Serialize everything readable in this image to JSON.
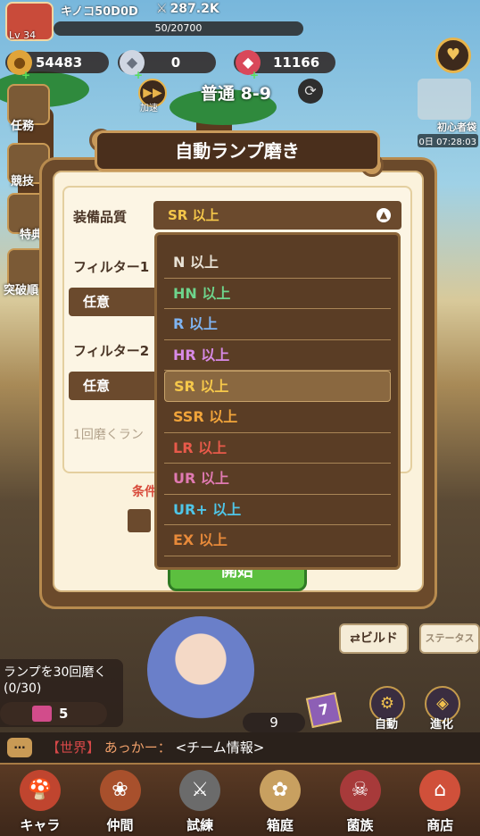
{
  "player": {
    "name": "キノコ50D0D",
    "level": "Lv 34",
    "power": "287.2K",
    "xp": "50/20700"
  },
  "currencies": {
    "gold": "54483",
    "diamond": "0",
    "gem": "11166"
  },
  "stage": {
    "label": "普通 8-9",
    "speed_label": "加速"
  },
  "side_menu": {
    "tasks": "任務",
    "arena": "競技",
    "special": "特典",
    "breakthrough": "突破順"
  },
  "newbie": {
    "label": "初心者袋",
    "timer": "0日 07:28:03"
  },
  "dialog": {
    "title": "自動ランプ磨き",
    "grade_label": "装備品質",
    "grade_value": "SR 以上",
    "filter1_label": "フィルター1",
    "filter1_value": "任意",
    "filter2_label": "フィルター2",
    "filter2_value": "任意",
    "polish_label": "1回磨くラン",
    "condition_label": "条件",
    "start_label": "開始"
  },
  "dropdown": {
    "options": [
      {
        "label": "N 以上",
        "color": "#e8e2d6"
      },
      {
        "label": "HN 以上",
        "color": "#6ed48c"
      },
      {
        "label": "R 以上",
        "color": "#7fb4f2"
      },
      {
        "label": "HR 以上",
        "color": "#d88ae6"
      },
      {
        "label": "SR 以上",
        "color": "#f6c84a"
      },
      {
        "label": "SSR 以上",
        "color": "#f1a43a"
      },
      {
        "label": "LR 以上",
        "color": "#e85a4a"
      },
      {
        "label": "UR 以上",
        "color": "#e07ab2"
      },
      {
        "label": "UR+ 以上",
        "color": "#4fc6e8"
      },
      {
        "label": "EX 以上",
        "color": "#e88a3a"
      }
    ],
    "selected_index": 4
  },
  "bottom": {
    "build": "ビルド",
    "status": "ステータス",
    "lamp_text": "ランプを30回磨く(0/30)",
    "lamp_count": "5",
    "lamp_level": "9",
    "card_level": "7",
    "auto": "自動",
    "evolve": "進化"
  },
  "chat": {
    "channel": "【世界】",
    "name": "あっかー：",
    "message": "<チーム情報>"
  },
  "nav": [
    {
      "label": "キャラ",
      "icon": "mushroom-icon"
    },
    {
      "label": "仲間",
      "icon": "paw-icon"
    },
    {
      "label": "試練",
      "icon": "swords-icon"
    },
    {
      "label": "箱庭",
      "icon": "garden-icon"
    },
    {
      "label": "菌族",
      "icon": "skull-icon"
    },
    {
      "label": "商店",
      "icon": "shop-icon"
    }
  ]
}
